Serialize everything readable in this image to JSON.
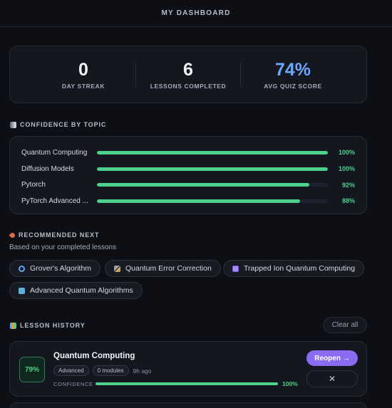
{
  "header": {
    "title": "MY DASHBOARD"
  },
  "stats": [
    {
      "value": "0",
      "label": "DAY STREAK"
    },
    {
      "value": "6",
      "label": "LESSONS COMPLETED"
    },
    {
      "value": "74%",
      "label": "AVG QUIZ SCORE"
    }
  ],
  "confidence": {
    "title": "CONFIDENCE BY TOPIC",
    "icon": "bar-chart-icon",
    "items": [
      {
        "label": "Quantum Computing",
        "percent_text": "100%",
        "value": 100
      },
      {
        "label": "Diffusion Models",
        "percent_text": "100%",
        "value": 100
      },
      {
        "label": "Pytorch",
        "percent_text": "92%",
        "value": 92
      },
      {
        "label": "PyTorch Advanced ...",
        "percent_text": "88%",
        "value": 88
      }
    ]
  },
  "recommended": {
    "title": "RECOMMENDED NEXT",
    "icon": "rocket-icon",
    "subtitle": "Based on your completed lessons",
    "chips": [
      {
        "label": "Grover's Algorithm",
        "icon": "magnifier-icon"
      },
      {
        "label": "Quantum Error Correction",
        "icon": "tools-icon"
      },
      {
        "label": "Trapped Ion Quantum Computing",
        "icon": "atom-icon"
      },
      {
        "label": "Advanced Quantum Algorithms",
        "icon": "book-icon"
      }
    ]
  },
  "history": {
    "title": "LESSON HISTORY",
    "icon": "books-icon",
    "clear_label": "Clear all",
    "lessons": [
      {
        "score": "79%",
        "title": "Quantum Computing",
        "level": "Advanced",
        "modules": "0 modules",
        "time": "9h ago",
        "confidence_label": "CONFIDENCE",
        "confidence_text": "100%",
        "confidence_value": 100,
        "reopen_label": "Reopen →",
        "dismiss_label": "✕"
      }
    ]
  },
  "colors": {
    "accent_green": "#4cd18a",
    "accent_purple": "#8b6cf0",
    "accent_blue": "#6aa8ff"
  }
}
